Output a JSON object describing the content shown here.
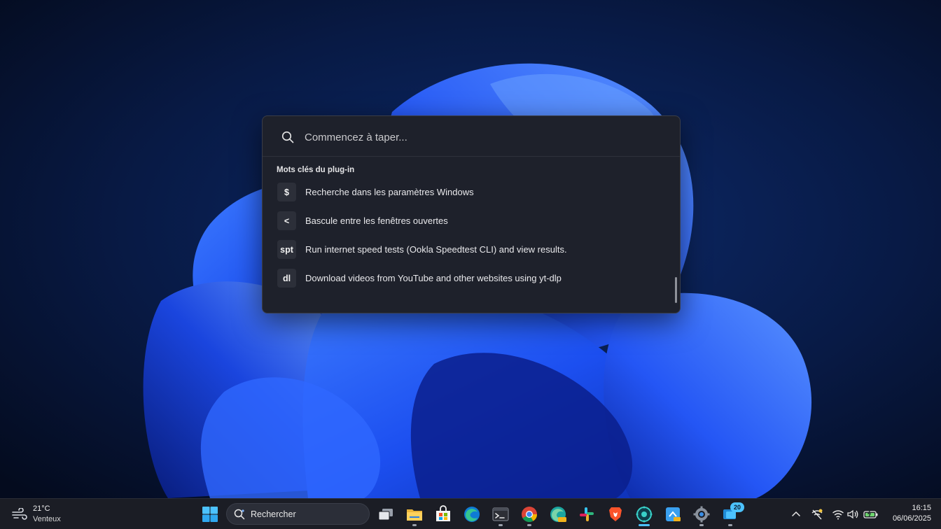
{
  "launcher": {
    "search_placeholder": "Commencez à taper...",
    "search_value": "",
    "section_title": "Mots clés du plug-in",
    "results": [
      {
        "keyword": "$",
        "label": "Recherche dans les paramètres Windows"
      },
      {
        "keyword": "<",
        "label": "Bascule entre les fenêtres ouvertes"
      },
      {
        "keyword": "spt",
        "label": "Run internet speed tests (Ookla Speedtest CLI) and view results."
      },
      {
        "keyword": "dl",
        "label": "Download videos from YouTube and other websites using yt-dlp"
      }
    ]
  },
  "taskbar": {
    "weather": {
      "temperature": "21°C",
      "condition": "Venteux",
      "icon": "wind-icon"
    },
    "search_label": "Rechercher",
    "apps": [
      {
        "name": "start-button",
        "icon": "windows-logo-icon"
      },
      {
        "name": "task-view",
        "icon": "task-view-icon"
      },
      {
        "name": "file-explorer",
        "icon": "folder-icon"
      },
      {
        "name": "microsoft-store",
        "icon": "store-icon"
      },
      {
        "name": "edge",
        "icon": "edge-icon"
      },
      {
        "name": "terminal",
        "icon": "terminal-icon"
      },
      {
        "name": "chrome",
        "icon": "chrome-icon"
      },
      {
        "name": "edge-canary",
        "icon": "edge-canary-icon"
      },
      {
        "name": "slack",
        "icon": "slack-icon"
      },
      {
        "name": "brave",
        "icon": "brave-icon"
      },
      {
        "name": "powertoys",
        "icon": "powertoys-icon"
      },
      {
        "name": "remote-desktop",
        "icon": "remote-desktop-icon"
      },
      {
        "name": "settings",
        "icon": "gear-icon"
      },
      {
        "name": "chat",
        "icon": "chat-icon"
      }
    ],
    "notification_count": "20",
    "clock": {
      "time": "16:15",
      "date": "06/06/2025"
    }
  },
  "colors": {
    "accent": "#4cc2ff",
    "launcher_bg": "#1e212b",
    "taskbar_bg": "#1b1d25"
  }
}
